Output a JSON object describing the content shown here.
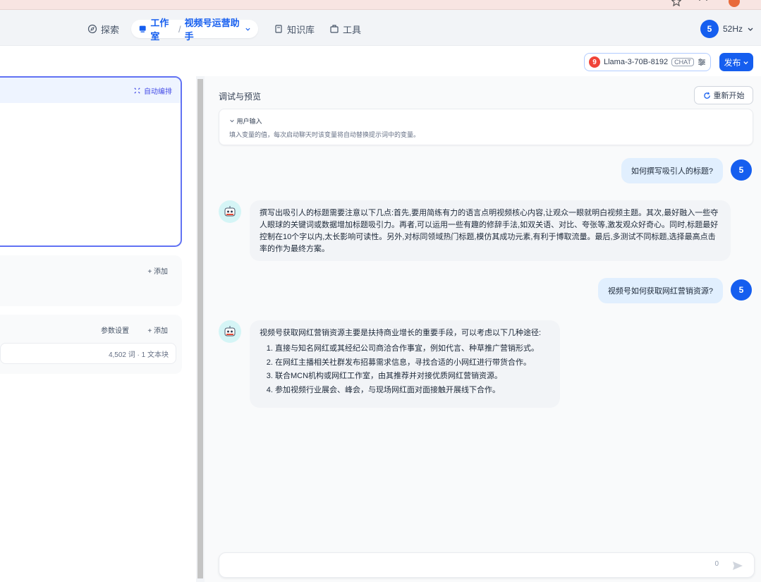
{
  "nav": {
    "explore": "探索",
    "studio": "工作室",
    "separator": "/",
    "app_name": "视频号运营助手",
    "knowledge": "知识库",
    "tools": "工具"
  },
  "user": {
    "avatar_letter": "5",
    "name": "52Hz"
  },
  "toolbar": {
    "model_badge": "9",
    "model_name": "Llama-3-70B-8192",
    "model_tag": "CHAT",
    "publish": "发布"
  },
  "left": {
    "auto_write": "自动编排",
    "add": "+ 添加",
    "param_settings": "参数设置",
    "kb_meta": "4,502 词 · 1 文本块"
  },
  "debug": {
    "title": "调试与预览",
    "restart": "重新开始",
    "var_title": "用户输入",
    "var_desc": "填入变量的值，每次启动聊天时该变量将自动替换提示词中的变量。"
  },
  "chat": {
    "user_avatar": "5",
    "messages": [
      {
        "role": "user",
        "text": "如何撰写吸引人的标题?"
      },
      {
        "role": "bot",
        "text": "撰写出吸引人的标题需要注意以下几点:首先,要用简练有力的语言点明视频核心内容,让观众一眼就明白视频主题。其次,最好融入一些夺人眼球的关键词或数据增加标题吸引力。再者,可以运用一些有趣的修辞手法,如双关语、对比、夸张等,激发观众好奇心。同时,标题最好控制在10个字以内,太长影响可读性。另外,对标同领域热门标题,模仿其成功元素,有利于博取流量。最后,多测试不同标题,选择最高点击率的作为最终方案。"
      },
      {
        "role": "user",
        "text": "视频号如何获取网红营销资源?"
      },
      {
        "role": "bot",
        "intro": "视频号获取网红营销资源主要是扶持商业增长的重要手段，可以考虑以下几种途径:",
        "items": [
          "直接与知名网红或其经纪公司商洽合作事宜，例如代言、种草推广营销形式。",
          "在网红主播相关社群发布招募需求信息，寻找合适的小网红进行带货合作。",
          "联合MCN机构或网红工作室，由其推荐并对接优质网红营销资源。",
          "参加视频行业展会、峰会，与现场网红面对面接触开展线下合作。"
        ]
      }
    ],
    "char_count": "0"
  }
}
